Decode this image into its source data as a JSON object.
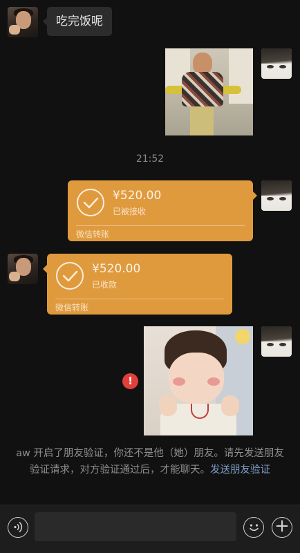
{
  "messages": {
    "friend_text": "吃完饭呢",
    "timestamp": "21:52"
  },
  "transfers": {
    "outgoing": {
      "amount": "¥520.00",
      "status": "已被接收",
      "label": "微信转账"
    },
    "incoming": {
      "amount": "¥520.00",
      "status": "已收款",
      "label": "微信转账"
    }
  },
  "system_notice": {
    "text": "aw 开启了朋友验证，你还不是他（她）朋友。请先发送朋友验证请求，对方验证通过后，才能聊天。",
    "link": "发送朋友验证"
  },
  "error_icon": "!",
  "input_bar": {
    "placeholder": "",
    "voice_icon": "voice-icon",
    "emoji_icon": "emoji-icon",
    "plus_icon": "plus-icon"
  },
  "colors": {
    "background": "#111111",
    "transfer_card": "#e09a3e",
    "bubble": "#2c2c2c",
    "link": "#7f9ec9",
    "error": "#e0403a"
  }
}
